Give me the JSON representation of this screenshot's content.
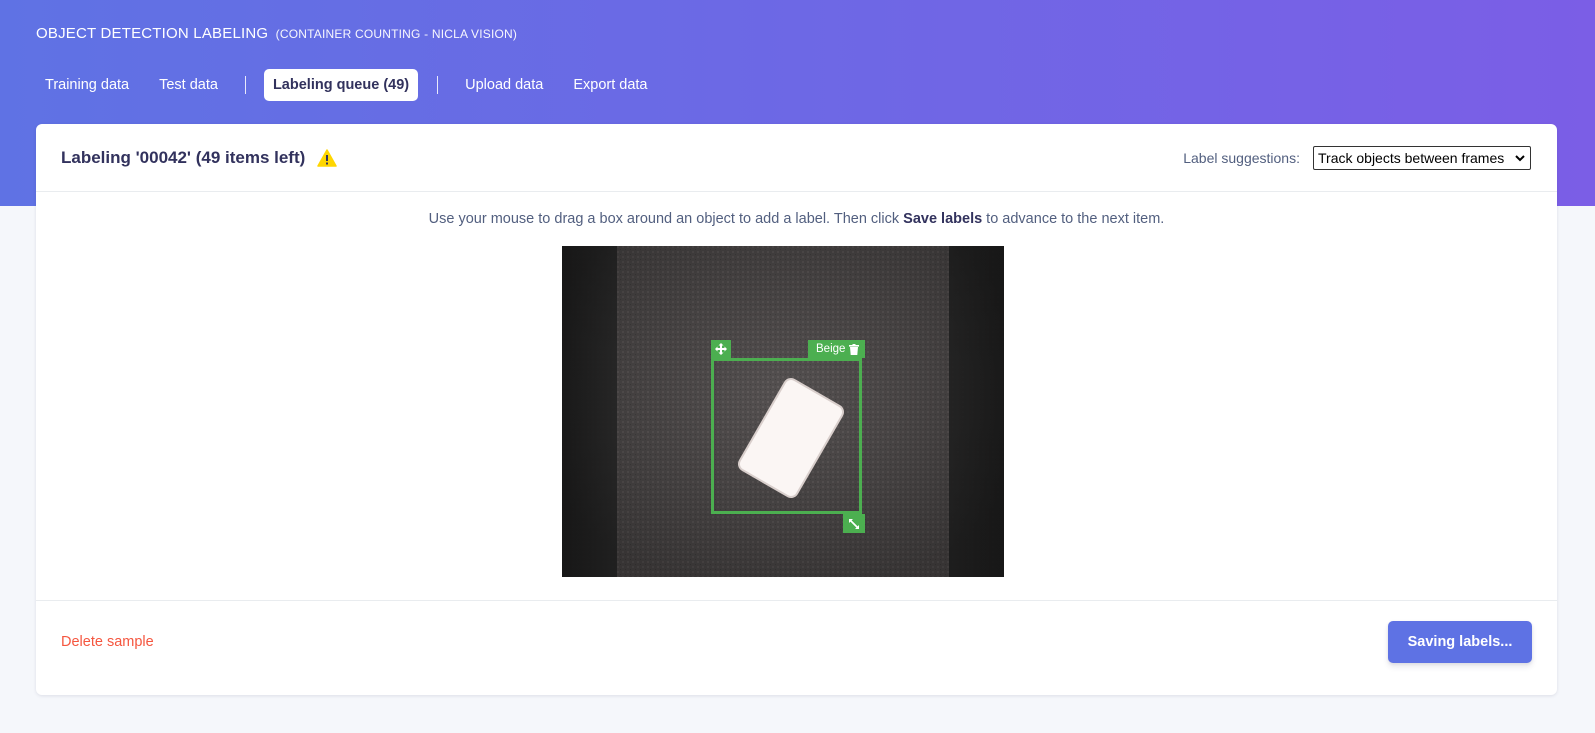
{
  "project": {
    "title": "Object detection labeling",
    "subtitle": "(Container counting - Nicla Vision)"
  },
  "nav": {
    "tabs": [
      {
        "label": "Training data",
        "active": false
      },
      {
        "label": "Test data",
        "active": false
      },
      {
        "label": "Labeling queue (49)",
        "active": true
      },
      {
        "label": "Upload data",
        "active": false
      },
      {
        "label": "Export data",
        "active": false
      }
    ]
  },
  "card": {
    "title": "Labeling '00042' (49 items left)",
    "warning_icon": "warning-triangle-icon",
    "suggestions_label": "Label suggestions:",
    "suggestions_selected": "Track objects between frames",
    "instruction_before": "Use your mouse to drag a box around an object to add a label. Then click ",
    "instruction_bold": "Save labels",
    "instruction_after": " to advance to the next item."
  },
  "bounding_box": {
    "label": "Beige",
    "color": "#4caf50"
  },
  "footer": {
    "delete_label": "Delete sample",
    "save_label": "Saving labels..."
  },
  "colors": {
    "accent": "#5e72e4",
    "danger": "#f5563f",
    "box": "#4caf50",
    "warning": "#ffd600"
  }
}
